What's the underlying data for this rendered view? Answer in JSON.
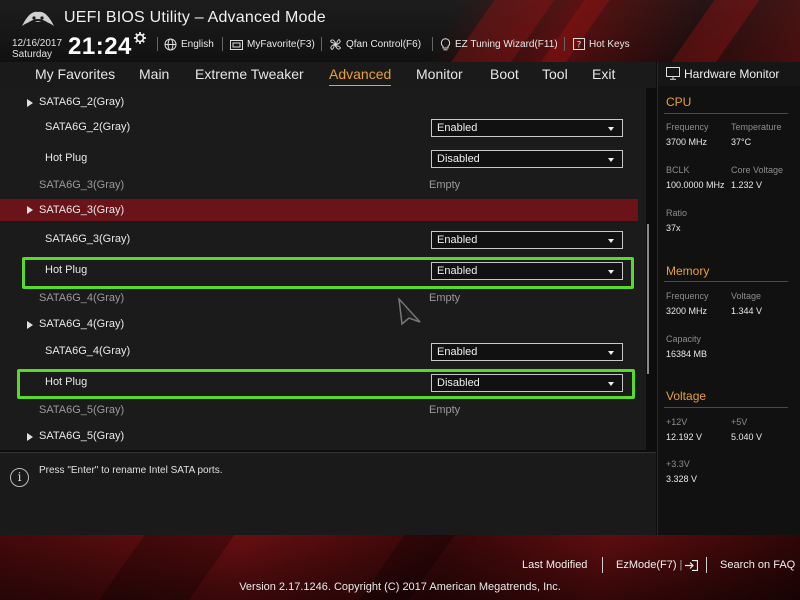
{
  "app": {
    "title": "UEFI BIOS Utility – Advanced Mode",
    "date": "12/16/2017",
    "day": "Saturday",
    "time": "21:24"
  },
  "toolbar": {
    "language": "English",
    "my_favorite": "MyFavorite(F3)",
    "qfan": "Qfan Control(F6)",
    "ez_tuning": "EZ Tuning Wizard(F11)",
    "hot_keys": "Hot Keys"
  },
  "nav": {
    "tabs": [
      {
        "label": "My Favorites"
      },
      {
        "label": "Main"
      },
      {
        "label": "Extreme Tweaker"
      },
      {
        "label": "Advanced",
        "active": true
      },
      {
        "label": "Monitor"
      },
      {
        "label": "Boot"
      },
      {
        "label": "Tool"
      },
      {
        "label": "Exit"
      }
    ]
  },
  "settings": {
    "rows": [
      {
        "type": "header",
        "label": "SATA6G_2(Gray)"
      },
      {
        "type": "dropdown",
        "label": "SATA6G_2(Gray)",
        "value": "Enabled"
      },
      {
        "type": "dropdown",
        "label": "Hot Plug",
        "value": "Disabled"
      },
      {
        "type": "info",
        "label": "SATA6G_3(Gray)",
        "value": "Empty"
      },
      {
        "type": "header",
        "label": "SATA6G_3(Gray)",
        "selected": true
      },
      {
        "type": "dropdown",
        "label": "SATA6G_3(Gray)",
        "value": "Enabled"
      },
      {
        "type": "dropdown",
        "label": "Hot Plug",
        "value": "Enabled",
        "outlined": true
      },
      {
        "type": "info",
        "label": "SATA6G_4(Gray)",
        "value": "Empty"
      },
      {
        "type": "header",
        "label": "SATA6G_4(Gray)"
      },
      {
        "type": "dropdown",
        "label": "SATA6G_4(Gray)",
        "value": "Enabled"
      },
      {
        "type": "dropdown",
        "label": "Hot Plug",
        "value": "Disabled",
        "outlined": true
      },
      {
        "type": "info",
        "label": "SATA6G_5(Gray)",
        "value": "Empty"
      },
      {
        "type": "header",
        "label": "SATA6G_5(Gray)"
      }
    ]
  },
  "help": {
    "text": "Press \"Enter\" to rename Intel SATA ports."
  },
  "hardware_monitor": {
    "title": "Hardware Monitor",
    "cpu": {
      "title": "CPU",
      "frequency_label": "Frequency",
      "frequency": "3700 MHz",
      "temperature_label": "Temperature",
      "temperature": "37°C",
      "bclk_label": "BCLK",
      "bclk": "100.0000 MHz",
      "core_voltage_label": "Core Voltage",
      "core_voltage": "1.232 V",
      "ratio_label": "Ratio",
      "ratio": "37x"
    },
    "memory": {
      "title": "Memory",
      "frequency_label": "Frequency",
      "frequency": "3200 MHz",
      "voltage_label": "Voltage",
      "voltage": "1.344 V",
      "capacity_label": "Capacity",
      "capacity": "16384 MB"
    },
    "voltage": {
      "title": "Voltage",
      "v12_label": "+12V",
      "v12": "12.192 V",
      "v5_label": "+5V",
      "v5": "5.040 V",
      "v33_label": "+3.3V",
      "v33": "3.328 V"
    }
  },
  "footer": {
    "last_modified": "Last Modified",
    "ez_mode": "EzMode(F7)",
    "search_faq": "Search on FAQ",
    "version": "Version 2.17.1246. Copyright (C) 2017 American Megatrends, Inc."
  },
  "colors": {
    "accent": "#e8a038",
    "highlight": "#58d92c",
    "selected_row": "#6a141a"
  }
}
